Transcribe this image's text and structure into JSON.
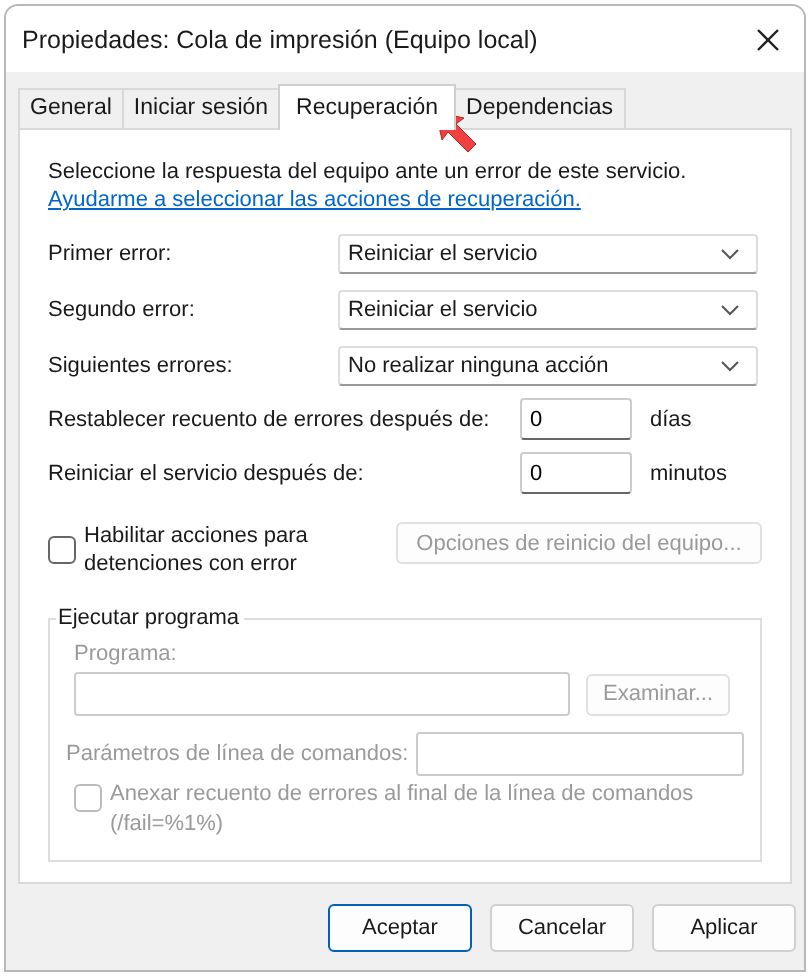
{
  "window": {
    "title": "Propiedades: Cola de impresión (Equipo local)"
  },
  "tabs": [
    {
      "label": "General",
      "selected": false
    },
    {
      "label": "Iniciar sesión",
      "selected": false
    },
    {
      "label": "Recuperación",
      "selected": true
    },
    {
      "label": "Dependencias",
      "selected": false
    }
  ],
  "description": "Seleccione la respuesta del equipo ante un error de este servicio.",
  "help_link": "Ayudarme a seleccionar las acciones de recuperación.",
  "failure_actions": [
    {
      "label": "Primer error:",
      "value": "Reiniciar el servicio"
    },
    {
      "label": "Segundo error:",
      "value": "Reiniciar el servicio"
    },
    {
      "label": "Siguientes errores:",
      "value": "No realizar ninguna acción"
    }
  ],
  "counters": [
    {
      "label": "Restablecer recuento de errores después de:",
      "value": "0",
      "unit": "días"
    },
    {
      "label": "Reiniciar el servicio después de:",
      "value": "0",
      "unit": "minutos"
    }
  ],
  "stop_errors": {
    "label": "Habilitar acciones para detenciones con error",
    "checked": false,
    "button": {
      "label": "Opciones de reinicio del equipo...",
      "disabled": true
    }
  },
  "run_program": {
    "title": "Ejecutar programa",
    "disabled": true,
    "program_label": "Programa:",
    "browse_button": "Examinar...",
    "params_label": "Parámetros de línea de comandos:",
    "append": {
      "label": "Anexar recuento de errores al final de la línea de comandos (/fail=%1%)",
      "checked": false
    }
  },
  "buttons": [
    {
      "label": "Aceptar",
      "default": true
    },
    {
      "label": "Cancelar",
      "default": false
    },
    {
      "label": "Aplicar",
      "default": false
    }
  ]
}
